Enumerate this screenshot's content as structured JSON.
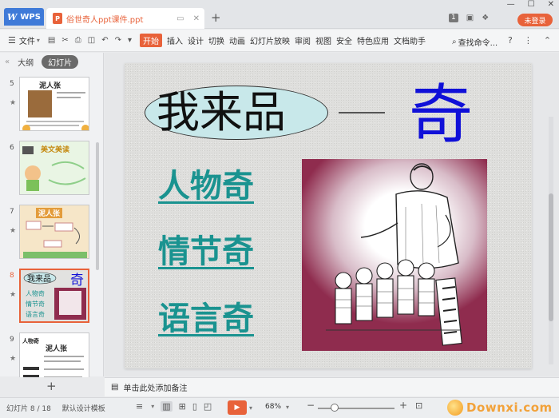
{
  "titlebar": {
    "app_label": "WPS",
    "doc_tab_name": "俗世奇人ppt课件.ppt",
    "doc_tab_icon_letter": "P",
    "new_tab": "+",
    "page_count_badge": "1",
    "login_button": "未登录"
  },
  "menubar": {
    "file_menu": "文件",
    "tabs": [
      "开始",
      "插入",
      "设计",
      "切换",
      "动画",
      "幻灯片放映",
      "审阅",
      "视图",
      "安全",
      "特色应用",
      "文档助手"
    ],
    "active_tab": "开始",
    "search_label": "查找命令...",
    "help": "?"
  },
  "left_panel": {
    "tabs": [
      "大纲",
      "幻灯片"
    ],
    "active_tab": "幻灯片",
    "add_slide": "+",
    "thumbnails": [
      {
        "index": "5",
        "title": "泥人张"
      },
      {
        "index": "6",
        "title": "美文美读"
      },
      {
        "index": "7",
        "title": "泥人张"
      },
      {
        "index": "8",
        "title": "我来品",
        "current": true
      },
      {
        "index": "9",
        "title": "泥人张",
        "subtitle": "人物奇"
      }
    ]
  },
  "slide": {
    "title": "我来品",
    "big_char": "奇",
    "items": [
      "人物奇",
      "情节奇",
      "语言奇"
    ],
    "colors": {
      "title_oval": "#c8e8ea",
      "big_char": "#1010d8",
      "items": "#1a9390",
      "illus_frame": "#8f2c4e"
    }
  },
  "notes": {
    "placeholder": "单击此处添加备注"
  },
  "statusbar": {
    "slide_counter": "幻灯片 8 / 18",
    "template": "默认设计模板",
    "zoom": "68%",
    "watermark": "Downxi.com"
  },
  "accent_color": "#e8623a"
}
